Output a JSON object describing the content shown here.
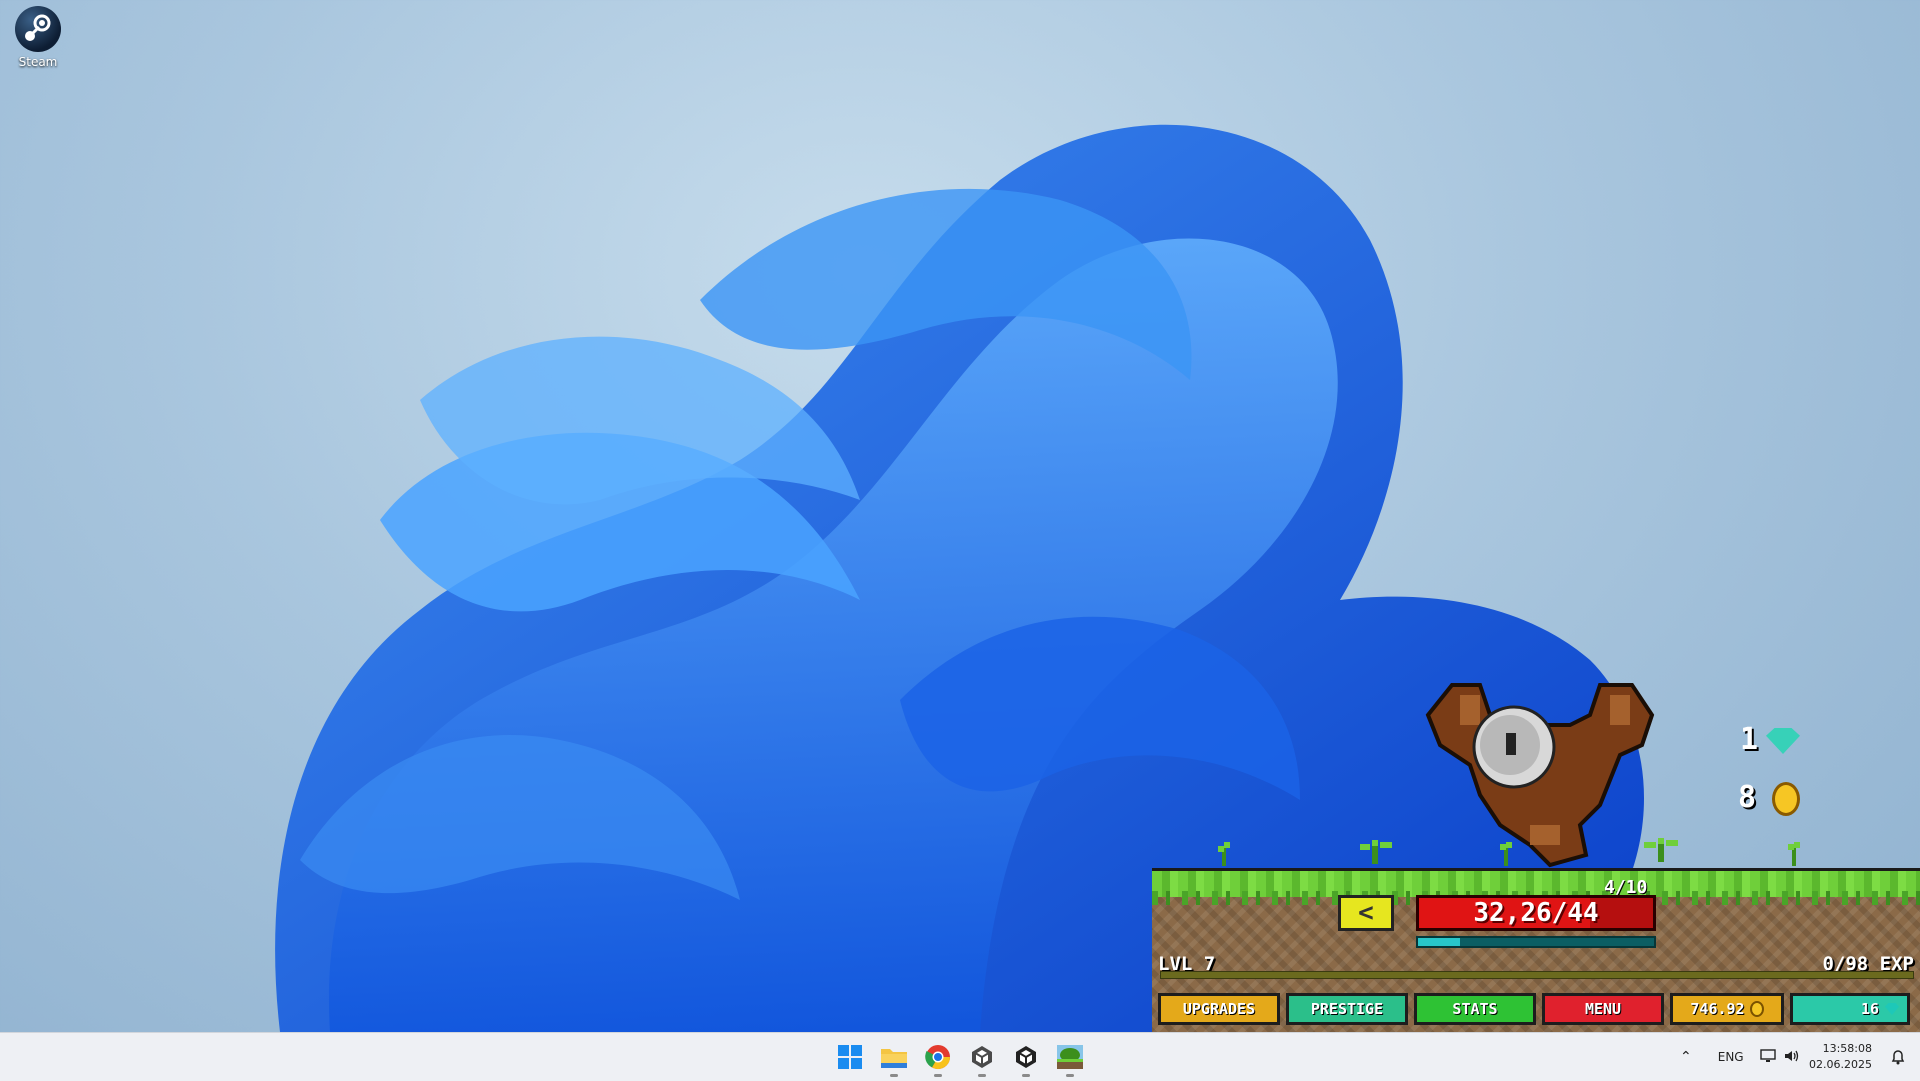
{
  "desktop": {
    "icons": [
      {
        "label": "Steam",
        "icon": "steam-icon"
      }
    ]
  },
  "game": {
    "back_label": "<",
    "hp_text": "32,26/44",
    "hp_fraction": 0.73,
    "kill_count": "4/10",
    "timer_fraction": 0.18,
    "level": "LVL 7",
    "exp": "0/98 EXP",
    "reward_gems": "1",
    "reward_coins": "8",
    "buttons": {
      "upgrades": "UPGRADES",
      "prestige": "PRESTIGE",
      "stats": "STATS",
      "menu": "MENU",
      "gold": "746.92",
      "gems": "16"
    },
    "colors": {
      "hp": "#e01414",
      "grass": "#6fcf3a",
      "dirt": "#8b6a48"
    }
  },
  "taskbar": {
    "apps": [
      "start-icon",
      "file-explorer-icon",
      "chrome-icon",
      "unity-icon",
      "unity-hub-icon",
      "game-icon"
    ],
    "tray": {
      "language": "ENG",
      "time": "13:58:08",
      "date": "02.06.2025"
    }
  }
}
